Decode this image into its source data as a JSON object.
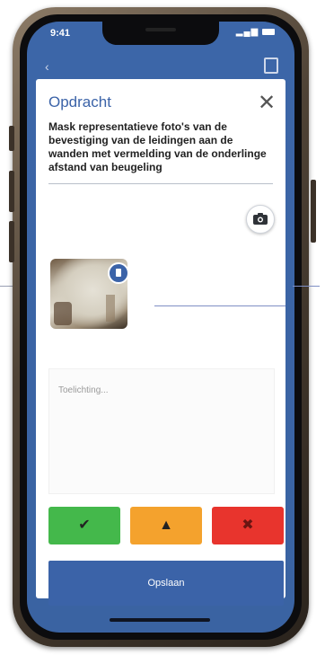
{
  "status_bar": {
    "time": "9:41"
  },
  "modal": {
    "title": "Opdracht",
    "close_symbol": "✕",
    "instruction": "Mask representatieve foto's van de bevestiging van de leidingen aan de wanden met vermelding van de onderlinge afstand van beugeling",
    "notes_placeholder": "Toelichting..."
  },
  "status_buttons": {
    "ok_symbol": "✔",
    "warn_symbol": "▲",
    "no_symbol": "✖"
  },
  "save_label": "Opslaan",
  "colors": {
    "brand_blue": "#3b63a8",
    "ok_green": "#44b84b",
    "warn_orange": "#f4a22d",
    "no_red": "#e8342d"
  },
  "icons": [
    "camera-icon",
    "trash-icon",
    "close-icon",
    "check-icon",
    "warning-icon",
    "cross-icon"
  ]
}
